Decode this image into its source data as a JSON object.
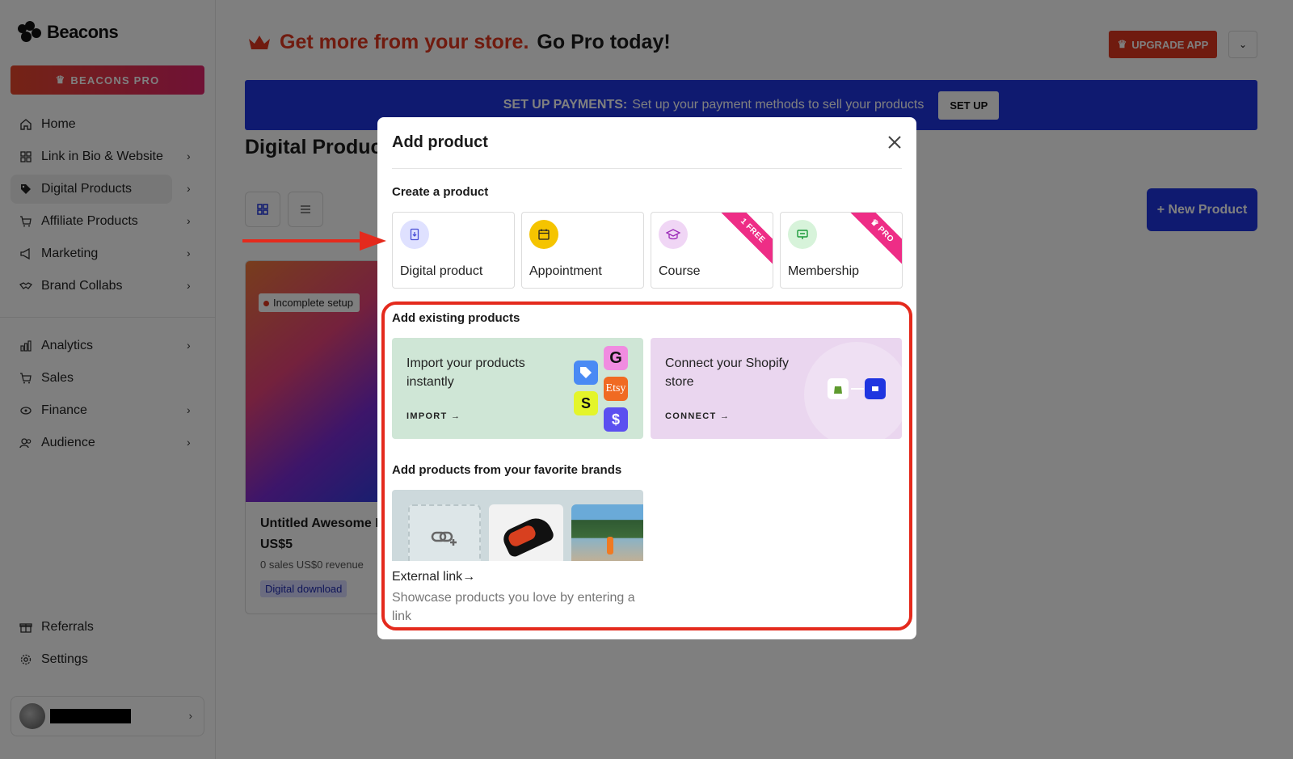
{
  "sidebar": {
    "logo_text": "Beacons",
    "pro_button": "BEACONS PRO",
    "items": [
      {
        "label": "Home",
        "icon": "home-icon",
        "chevron": false
      },
      {
        "label": "Link in Bio & Website",
        "icon": "grid-icon",
        "chevron": true
      },
      {
        "label": "Digital Products",
        "icon": "tag-icon",
        "chevron": true,
        "active": true
      },
      {
        "label": "Affiliate Products",
        "icon": "cart-icon",
        "chevron": true
      },
      {
        "label": "Marketing",
        "icon": "megaphone-icon",
        "chevron": true
      },
      {
        "label": "Brand Collabs",
        "icon": "handshake-icon",
        "chevron": true
      }
    ],
    "items2": [
      {
        "label": "Analytics",
        "icon": "bar-chart-icon",
        "chevron": true
      },
      {
        "label": "Sales",
        "icon": "cart-icon",
        "chevron": false
      },
      {
        "label": "Finance",
        "icon": "money-icon",
        "chevron": true
      },
      {
        "label": "Audience",
        "icon": "people-icon",
        "chevron": true
      }
    ],
    "items3": [
      {
        "label": "Referrals",
        "icon": "gift-icon"
      },
      {
        "label": "Settings",
        "icon": "gear-icon"
      }
    ]
  },
  "header": {
    "promo_accent": "Get more from your store.",
    "promo_rest": "Go Pro today!",
    "upgrade_button": "UPGRADE APP"
  },
  "payments_bar": {
    "bold": "SET UP PAYMENTS:",
    "text": "Set up your payment methods to sell your products",
    "button": "SET UP"
  },
  "page": {
    "title": "Digital Products",
    "new_button": "+ New Product"
  },
  "product_card": {
    "badge": "Incomplete setup",
    "name": "Untitled Awesome Product",
    "price": "US$5",
    "stats": "0 sales   US$0 revenue",
    "tag": "Digital download"
  },
  "modal": {
    "title": "Add product",
    "create_label": "Create a product",
    "types": [
      {
        "label": "Digital product",
        "icon": "download-file-icon",
        "icon_bg": "#dfe1ff",
        "ribbon": ""
      },
      {
        "label": "Appointment",
        "icon": "calendar-icon",
        "icon_bg": "#f5c400",
        "ribbon": ""
      },
      {
        "label": "Course",
        "icon": "graduation-cap-icon",
        "icon_bg": "#f0d6f5",
        "ribbon": "1 FREE"
      },
      {
        "label": "Membership",
        "icon": "membership-card-icon",
        "icon_bg": "#d7f3da",
        "ribbon": "PRO"
      }
    ],
    "existing_label": "Add existing products",
    "import_card": {
      "title": "Import your products instantly",
      "link": "IMPORT",
      "bg": "#cfe6d6"
    },
    "connect_card": {
      "title": "Connect your Shopify store",
      "link": "CONNECT",
      "bg": "#ead6ef"
    },
    "import_logos": [
      "G",
      "Etsy",
      "S",
      "$"
    ],
    "brands_label": "Add products from your favorite brands",
    "external_link": "External link",
    "external_desc": "Showcase products you love by entering a link"
  },
  "colors": {
    "brand_blue": "#1f35e0",
    "accent_red": "#e0361f",
    "pro_pink": "#ee2d86"
  }
}
